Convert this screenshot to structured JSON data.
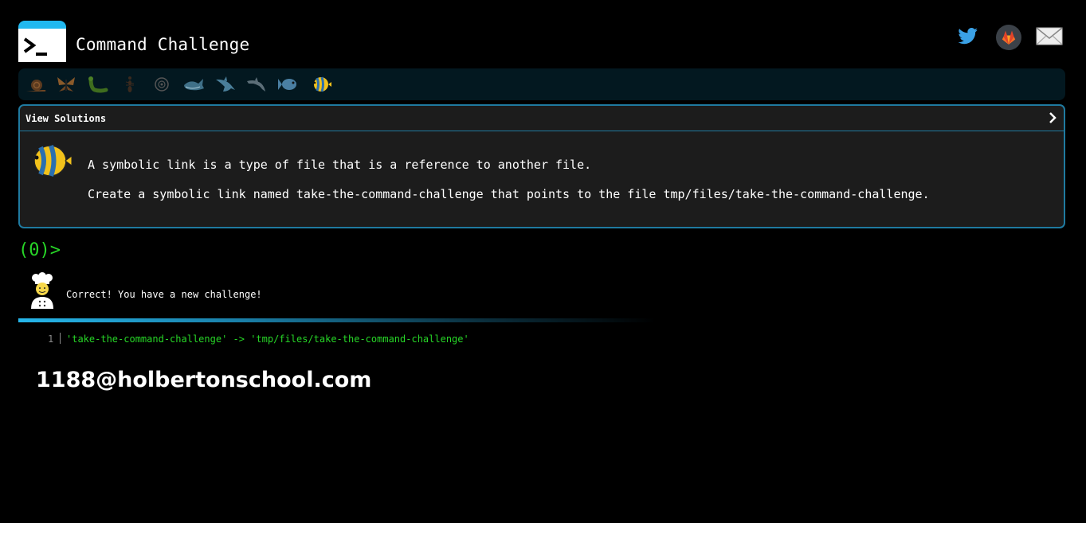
{
  "header": {
    "title": "Command Challenge",
    "icons": [
      "terminal-prompt-icon",
      "twitter-icon",
      "gitlab-icon",
      "mail-icon"
    ]
  },
  "levels": {
    "icons": [
      "snail-icon",
      "butterfly-icon",
      "worm-icon",
      "ant-icon",
      "cell-icon",
      "whale-icon",
      "shark-icon",
      "dolphin-icon",
      "fish-icon",
      "tropical-fish-icon"
    ],
    "current": 10
  },
  "challenge": {
    "toggle_label": "View Solutions",
    "line1": "A symbolic link is a type of file that is a reference to another file.",
    "line2": "Create a symbolic link named take-the-command-challenge that points to the file tmp/files/take-the-command-challenge."
  },
  "prompt": {
    "text": "(0)>"
  },
  "result": {
    "message": "Correct! You have a new challenge!",
    "line_number": "1",
    "output": "'take-the-command-challenge' -> 'tmp/files/take-the-command-challenge'"
  },
  "user": {
    "email": "1188@holbertonschool.com"
  },
  "colors": {
    "accent": "#20b8f0",
    "prompt_green": "#27d627",
    "panel_border": "#1f7aa0",
    "panel_bg": "#1c1c1c",
    "bar_bg": "#031820"
  }
}
